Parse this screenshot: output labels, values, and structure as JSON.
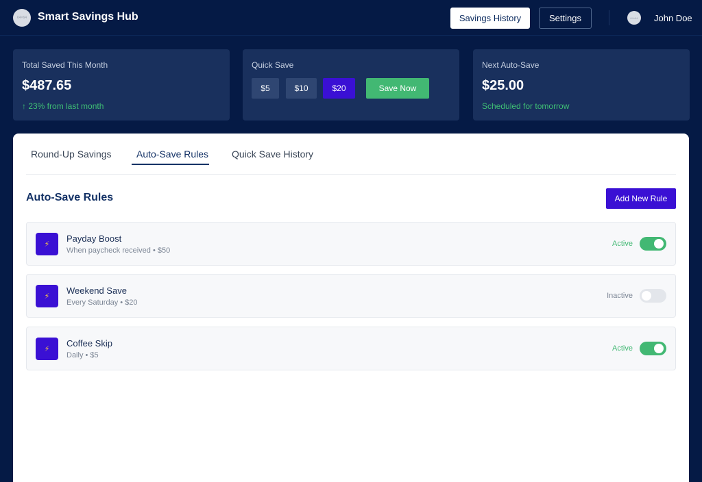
{
  "header": {
    "logo_text": "64×64",
    "app_title": "Smart Savings Hub",
    "history_button": "Savings History",
    "settings_button": "Settings",
    "avatar_text": "64×64",
    "user_name": "John Doe"
  },
  "stats": {
    "total_saved": {
      "label": "Total Saved This Month",
      "value": "$487.65",
      "change": "↑ 23% from last month"
    },
    "quick_save": {
      "label": "Quick Save",
      "amounts": [
        "$5",
        "$10",
        "$20"
      ],
      "selected_amount": "$20",
      "save_button": "Save Now"
    },
    "next_auto_save": {
      "label": "Next Auto-Save",
      "value": "$25.00",
      "schedule": "Scheduled for tomorrow"
    }
  },
  "tabs": [
    {
      "label": "Round-Up Savings",
      "active": false
    },
    {
      "label": "Auto-Save Rules",
      "active": true
    },
    {
      "label": "Quick Save History",
      "active": false
    }
  ],
  "rules_section": {
    "title": "Auto-Save Rules",
    "add_button": "Add New Rule",
    "rules": [
      {
        "icon": "lightning-icon",
        "name": "Payday Boost",
        "description": "When paycheck received • $50",
        "status": "Active",
        "enabled": true
      },
      {
        "icon": "lightning-icon",
        "name": "Weekend Save",
        "description": "Every Saturday • $20",
        "status": "Inactive",
        "enabled": false
      },
      {
        "icon": "lightning-icon",
        "name": "Coffee Skip",
        "description": "Daily • $5",
        "status": "Active",
        "enabled": true
      }
    ]
  },
  "colors": {
    "background": "#051a45",
    "card": "#19305d",
    "accent_purple": "#3a10d4",
    "success_green": "#42b873",
    "title_navy": "#143266"
  }
}
